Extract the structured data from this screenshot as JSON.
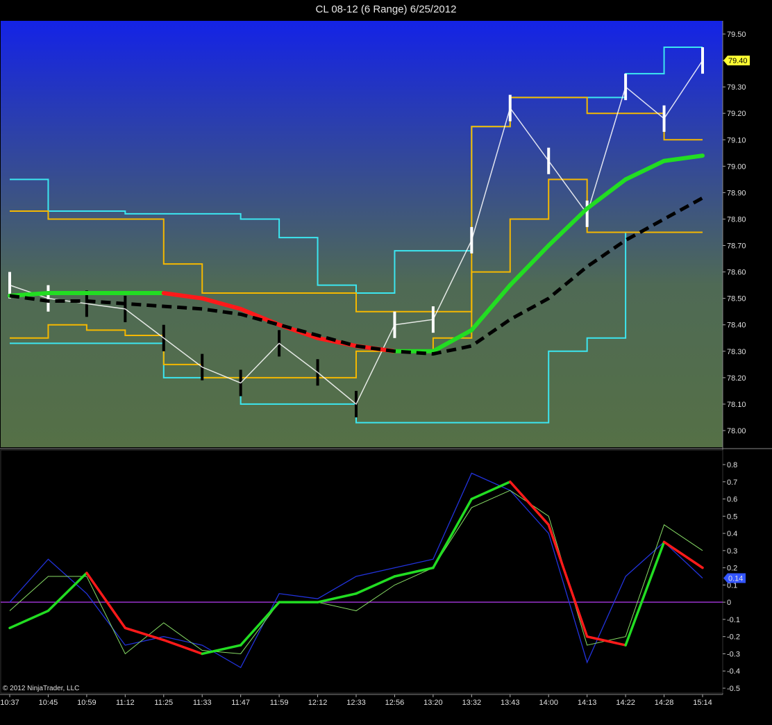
{
  "title": "CL 08-12 (6 Range)  6/25/2012",
  "copyright": "© 2012 NinjaTrader, LLC",
  "colors": {
    "price_bg_top": "#1423e6",
    "price_bg_bottom": "#557046",
    "channel_outer": "#3ce6f0",
    "channel_inner": "#f5b800",
    "ma_up": "#22dd22",
    "ma_down": "#ff1a1a",
    "ma_slow": "#000000",
    "osc_fast": "#2233dd",
    "zero_line": "#9933cc",
    "last_price_tag": "#ffff33",
    "osc_tag": "#3355ff"
  },
  "price_panel": {
    "last_price_label": "79.40",
    "y_ticks": [
      "79.50",
      "79.40",
      "79.30",
      "79.20",
      "79.10",
      "79.00",
      "78.90",
      "78.80",
      "78.70",
      "78.60",
      "78.50",
      "78.40",
      "78.30",
      "78.20",
      "78.10",
      "78.00"
    ]
  },
  "oscillator_panel": {
    "last_value_label": "0.14",
    "y_ticks": [
      "0.8",
      "0.7",
      "0.6",
      "0.5",
      "0.4",
      "0.3",
      "0.2",
      "0.1",
      "0",
      "-0.1",
      "-0.2",
      "-0.3",
      "-0.4",
      "-0.5"
    ]
  },
  "x_ticks": [
    "10:37",
    "10:45",
    "10:59",
    "11:12",
    "11:25",
    "11:33",
    "11:47",
    "11:59",
    "12:12",
    "12:33",
    "12:56",
    "13:20",
    "13:32",
    "13:43",
    "14:00",
    "14:13",
    "14:22",
    "14:28",
    "15:14"
  ],
  "chart_data": {
    "type": "line",
    "title": "CL 08-12 (6 Range)  6/25/2012",
    "x": [
      "10:37",
      "10:45",
      "10:59",
      "11:12",
      "11:25",
      "11:33",
      "11:47",
      "11:59",
      "12:12",
      "12:33",
      "12:56",
      "13:20",
      "13:32",
      "13:43",
      "14:00",
      "14:13",
      "14:22",
      "14:28",
      "15:14"
    ],
    "price": {
      "ylim": [
        77.97,
        79.53
      ],
      "series": [
        {
          "values": [
            78.55,
            78.5,
            78.48,
            78.46,
            78.35,
            78.24,
            78.18,
            78.33,
            78.22,
            78.1,
            78.4,
            78.42,
            78.72,
            79.22,
            79.02,
            78.82,
            79.3,
            79.18,
            79.4
          ]
        },
        {
          "values": [
            78.95,
            78.83,
            78.83,
            78.82,
            78.82,
            78.82,
            78.8,
            78.73,
            78.55,
            78.52,
            78.68,
            78.68,
            79.15,
            79.26,
            79.26,
            79.26,
            79.35,
            79.45,
            79.45
          ]
        },
        {
          "values": [
            78.33,
            78.33,
            78.33,
            78.33,
            78.2,
            78.2,
            78.1,
            78.1,
            78.1,
            78.03,
            78.03,
            78.03,
            78.03,
            78.03,
            78.3,
            78.35,
            78.75,
            78.75,
            78.75
          ]
        },
        {
          "values": [
            78.83,
            78.8,
            78.8,
            78.8,
            78.63,
            78.52,
            78.52,
            78.52,
            78.52,
            78.45,
            78.45,
            78.45,
            79.15,
            79.26,
            79.26,
            79.2,
            79.2,
            79.1,
            79.1
          ]
        },
        {
          "values": [
            78.35,
            78.4,
            78.38,
            78.36,
            78.25,
            78.2,
            78.2,
            78.2,
            78.2,
            78.3,
            78.3,
            78.35,
            78.6,
            78.8,
            78.95,
            78.75,
            78.75,
            78.75,
            78.75
          ]
        },
        {
          "values": [
            78.51,
            78.52,
            78.52,
            78.52,
            78.52,
            78.5,
            78.46,
            78.4,
            78.35,
            78.32,
            78.3,
            78.3,
            78.38,
            78.55,
            78.7,
            78.84,
            78.95,
            79.02,
            79.04
          ]
        },
        {
          "values": [
            78.51,
            78.49,
            78.49,
            78.48,
            78.47,
            78.46,
            78.44,
            78.4,
            78.36,
            78.32,
            78.3,
            78.29,
            78.32,
            78.42,
            78.5,
            78.62,
            78.72,
            78.8,
            78.88
          ]
        }
      ]
    },
    "oscillator": {
      "ylim": [
        -0.5,
        0.83
      ],
      "series": [
        {
          "values": [
            0.0,
            0.25,
            0.05,
            -0.25,
            -0.2,
            -0.25,
            -0.38,
            0.05,
            0.02,
            0.15,
            0.2,
            0.25,
            0.75,
            0.65,
            0.4,
            -0.35,
            0.15,
            0.35,
            0.14
          ]
        },
        {
          "values": [
            -0.05,
            0.15,
            0.15,
            -0.3,
            -0.12,
            -0.28,
            -0.3,
            0.0,
            0.0,
            -0.05,
            0.1,
            0.2,
            0.55,
            0.65,
            0.5,
            -0.25,
            -0.2,
            0.45,
            0.3
          ]
        },
        {
          "values": [
            -0.15,
            -0.05,
            0.17,
            -0.15,
            -0.22,
            -0.3,
            -0.25,
            0.0,
            0.0,
            0.05,
            0.15,
            0.2,
            0.6,
            0.7,
            0.45,
            -0.2,
            -0.25,
            0.35,
            0.2
          ]
        }
      ]
    }
  }
}
